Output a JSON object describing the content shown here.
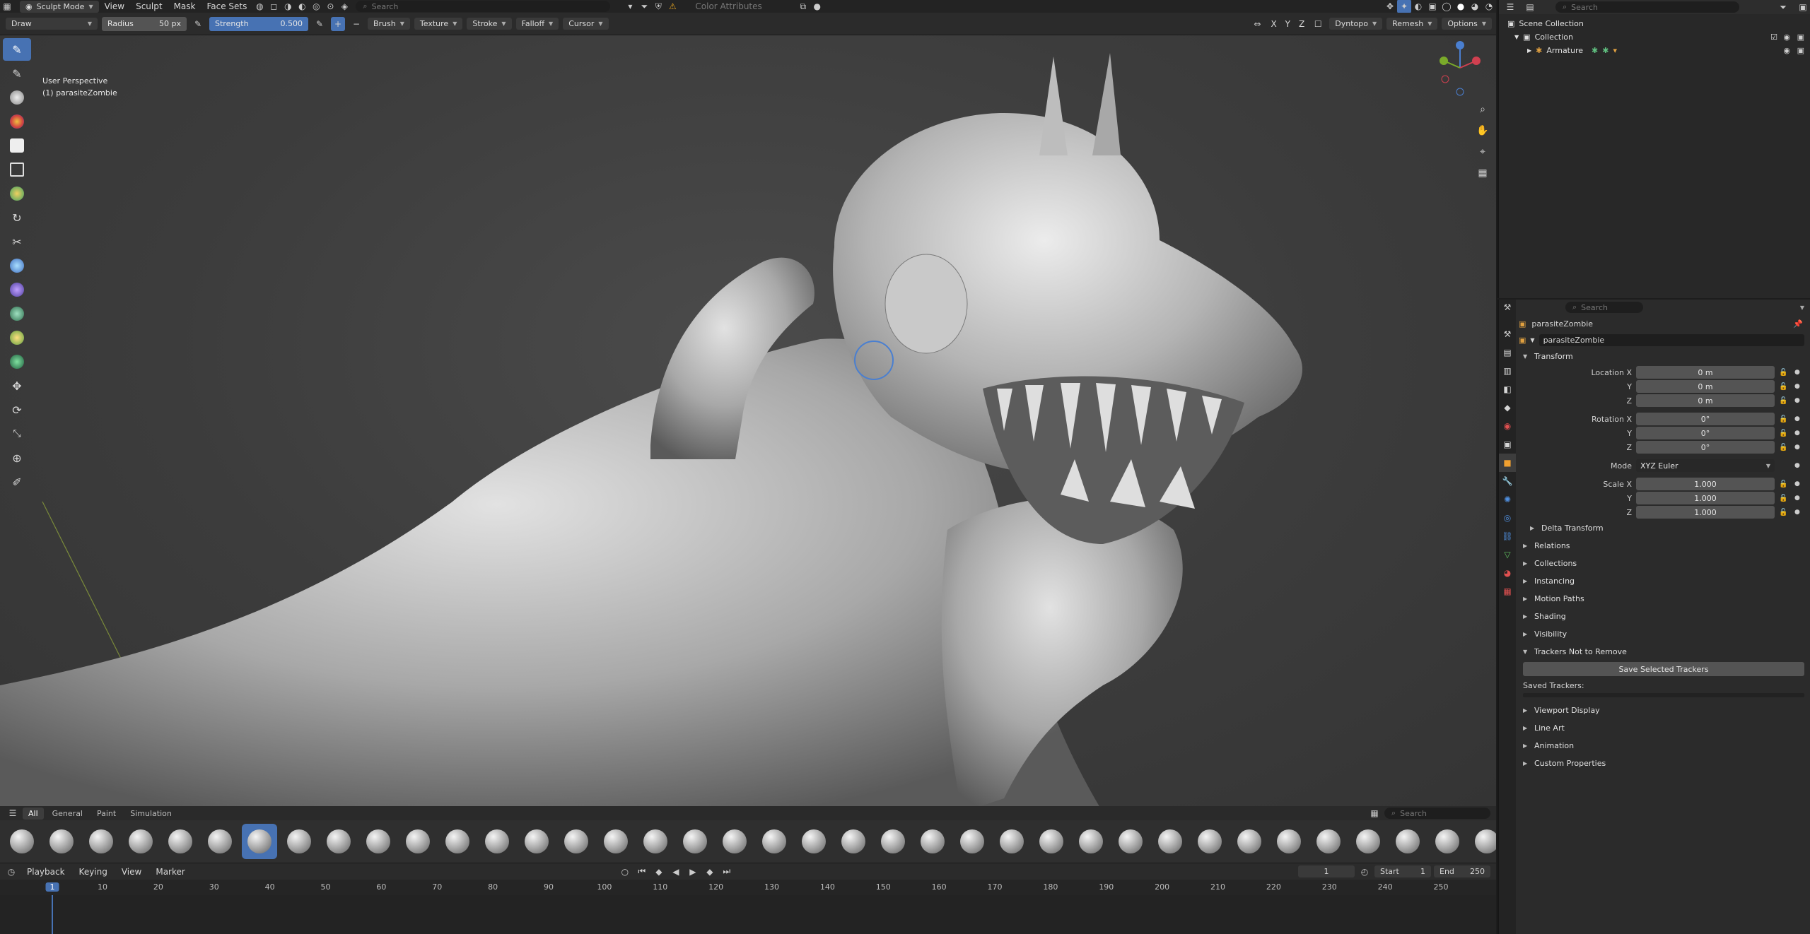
{
  "topbar": {
    "mode": "Sculpt Mode",
    "menus": [
      "View",
      "Sculpt",
      "Mask",
      "Face Sets"
    ],
    "search_placeholder": "Search",
    "color_attributes": "Color Attributes"
  },
  "tool_header": {
    "tool": "Draw",
    "radius_label": "Radius",
    "radius_value": "50 px",
    "strength_label": "Strength",
    "strength_value": "0.500",
    "menus": [
      "Brush",
      "Texture",
      "Stroke",
      "Falloff",
      "Cursor"
    ],
    "axes": [
      "X",
      "Y",
      "Z"
    ],
    "dyntopo": "Dyntopo",
    "remesh": "Remesh",
    "options": "Options"
  },
  "viewport": {
    "perspective": "User Perspective",
    "object": "(1) parasiteZombie"
  },
  "shelf": {
    "tabs": [
      "All",
      "General",
      "Paint",
      "Simulation"
    ],
    "search_placeholder": "Search",
    "brush_count": 38,
    "active_index": 6
  },
  "timeline": {
    "menus": [
      "Playback",
      "Keying",
      "View",
      "Marker"
    ],
    "current_frame": "1",
    "start_label": "Start",
    "start_value": "1",
    "end_label": "End",
    "end_value": "250",
    "ticks": [
      "1",
      "10",
      "20",
      "30",
      "40",
      "50",
      "60",
      "70",
      "80",
      "90",
      "100",
      "110",
      "120",
      "130",
      "140",
      "150",
      "160",
      "170",
      "180",
      "190",
      "200",
      "210",
      "220",
      "230",
      "240",
      "250"
    ]
  },
  "outliner": {
    "search_placeholder": "Search",
    "scene_collection": "Scene Collection",
    "collection": "Collection",
    "armature": "Armature"
  },
  "properties": {
    "search_placeholder": "Search",
    "object_name": "parasiteZombie",
    "object_field": "parasiteZombie",
    "transform": "Transform",
    "location_label": "Location X",
    "y_label": "Y",
    "z_label": "Z",
    "location": [
      "0 m",
      "0 m",
      "0 m"
    ],
    "rotation_label": "Rotation X",
    "rotation": [
      "0°",
      "0°",
      "0°"
    ],
    "mode_label": "Mode",
    "mode_value": "XYZ Euler",
    "scale_label": "Scale X",
    "scale": [
      "1.000",
      "1.000",
      "1.000"
    ],
    "delta_transform": "Delta Transform",
    "panels_a": [
      "Relations",
      "Collections",
      "Instancing",
      "Motion Paths",
      "Shading",
      "Visibility"
    ],
    "trackers_panel": "Trackers Not to Remove",
    "save_trackers": "Save Selected Trackers",
    "saved_trackers": "Saved Trackers:",
    "panels_b": [
      "Viewport Display",
      "Line Art",
      "Animation",
      "Custom Properties"
    ]
  }
}
